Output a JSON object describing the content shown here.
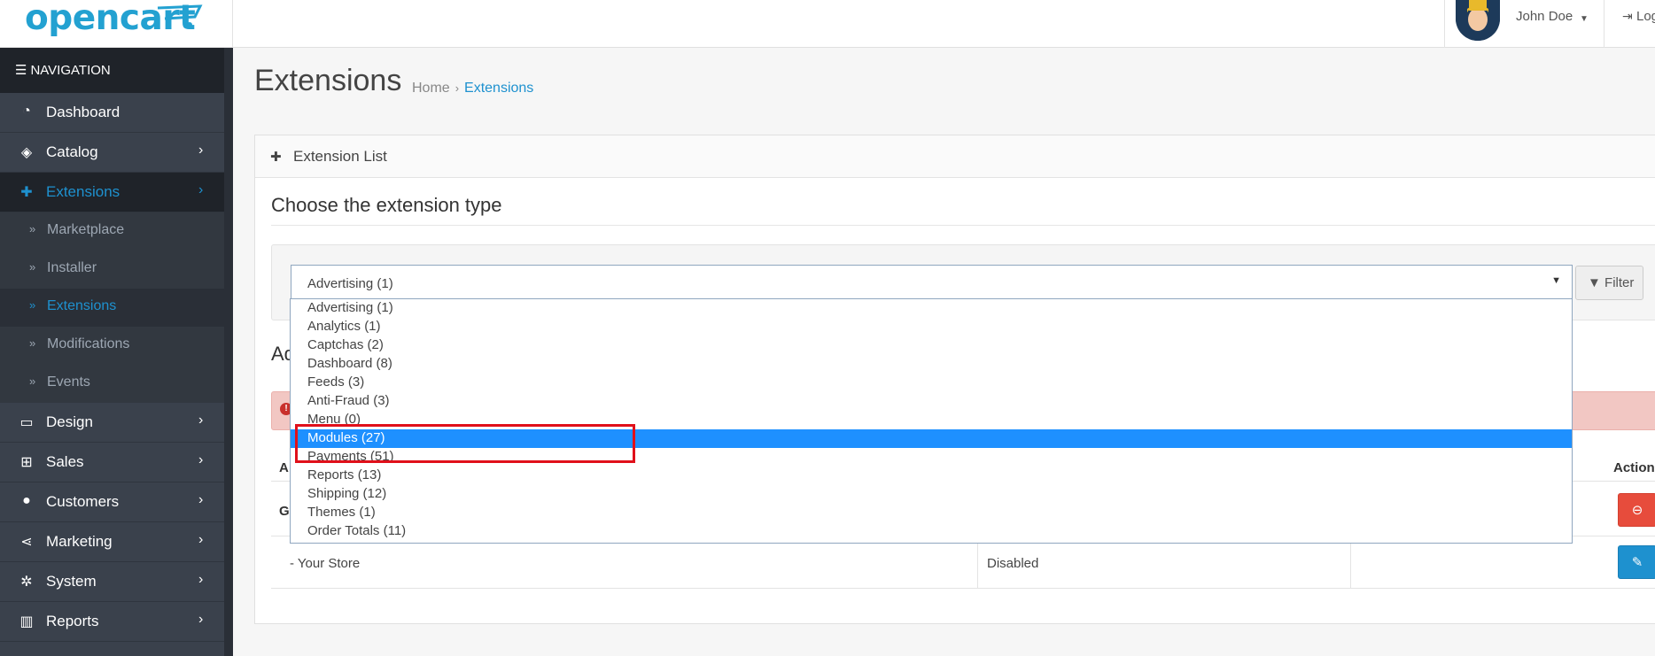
{
  "header": {
    "logo": "opencart",
    "user_name": "John Doe",
    "logout": "Logout"
  },
  "sidebar": {
    "heading": "NAVIGATION",
    "items": [
      {
        "label": "Dashboard",
        "icon": "dashboard-icon"
      },
      {
        "label": "Catalog",
        "icon": "tags-icon"
      },
      {
        "label": "Extensions",
        "icon": "puzzle-icon"
      },
      {
        "label": "Design",
        "icon": "monitor-icon"
      },
      {
        "label": "Sales",
        "icon": "cart-icon"
      },
      {
        "label": "Customers",
        "icon": "user-icon"
      },
      {
        "label": "Marketing",
        "icon": "share-icon"
      },
      {
        "label": "System",
        "icon": "gear-icon"
      },
      {
        "label": "Reports",
        "icon": "bar-chart-icon"
      }
    ],
    "subitems": [
      "Marketplace",
      "Installer",
      "Extensions",
      "Modifications",
      "Events"
    ]
  },
  "page": {
    "title": "Extensions",
    "breadcrumb": [
      "Home",
      "Extensions"
    ]
  },
  "panel": {
    "title": "Extension List",
    "choose_heading": "Choose the extension type",
    "selected_value": "Advertising (1)",
    "filter_label": "Filter",
    "section_partial": "Ad",
    "table_head_partial": "A",
    "action_label": "Action",
    "row_partial": "G",
    "store_label": "-  Your Store",
    "store_status": "Disabled"
  },
  "dropdown": {
    "options": [
      "Advertising (1)",
      "Analytics (1)",
      "Captchas (2)",
      "Dashboard (8)",
      "Feeds (3)",
      "Anti-Fraud (3)",
      "Menu (0)",
      "Modules (27)",
      "Payments (51)",
      "Reports (13)",
      "Shipping (12)",
      "Themes (1)",
      "Order Totals (11)"
    ],
    "selected_index": 7
  },
  "colors": {
    "accent": "#1e91cf",
    "sidebar": "#3a414c",
    "highlight": "#e0101a",
    "selected": "#1e90ff"
  }
}
